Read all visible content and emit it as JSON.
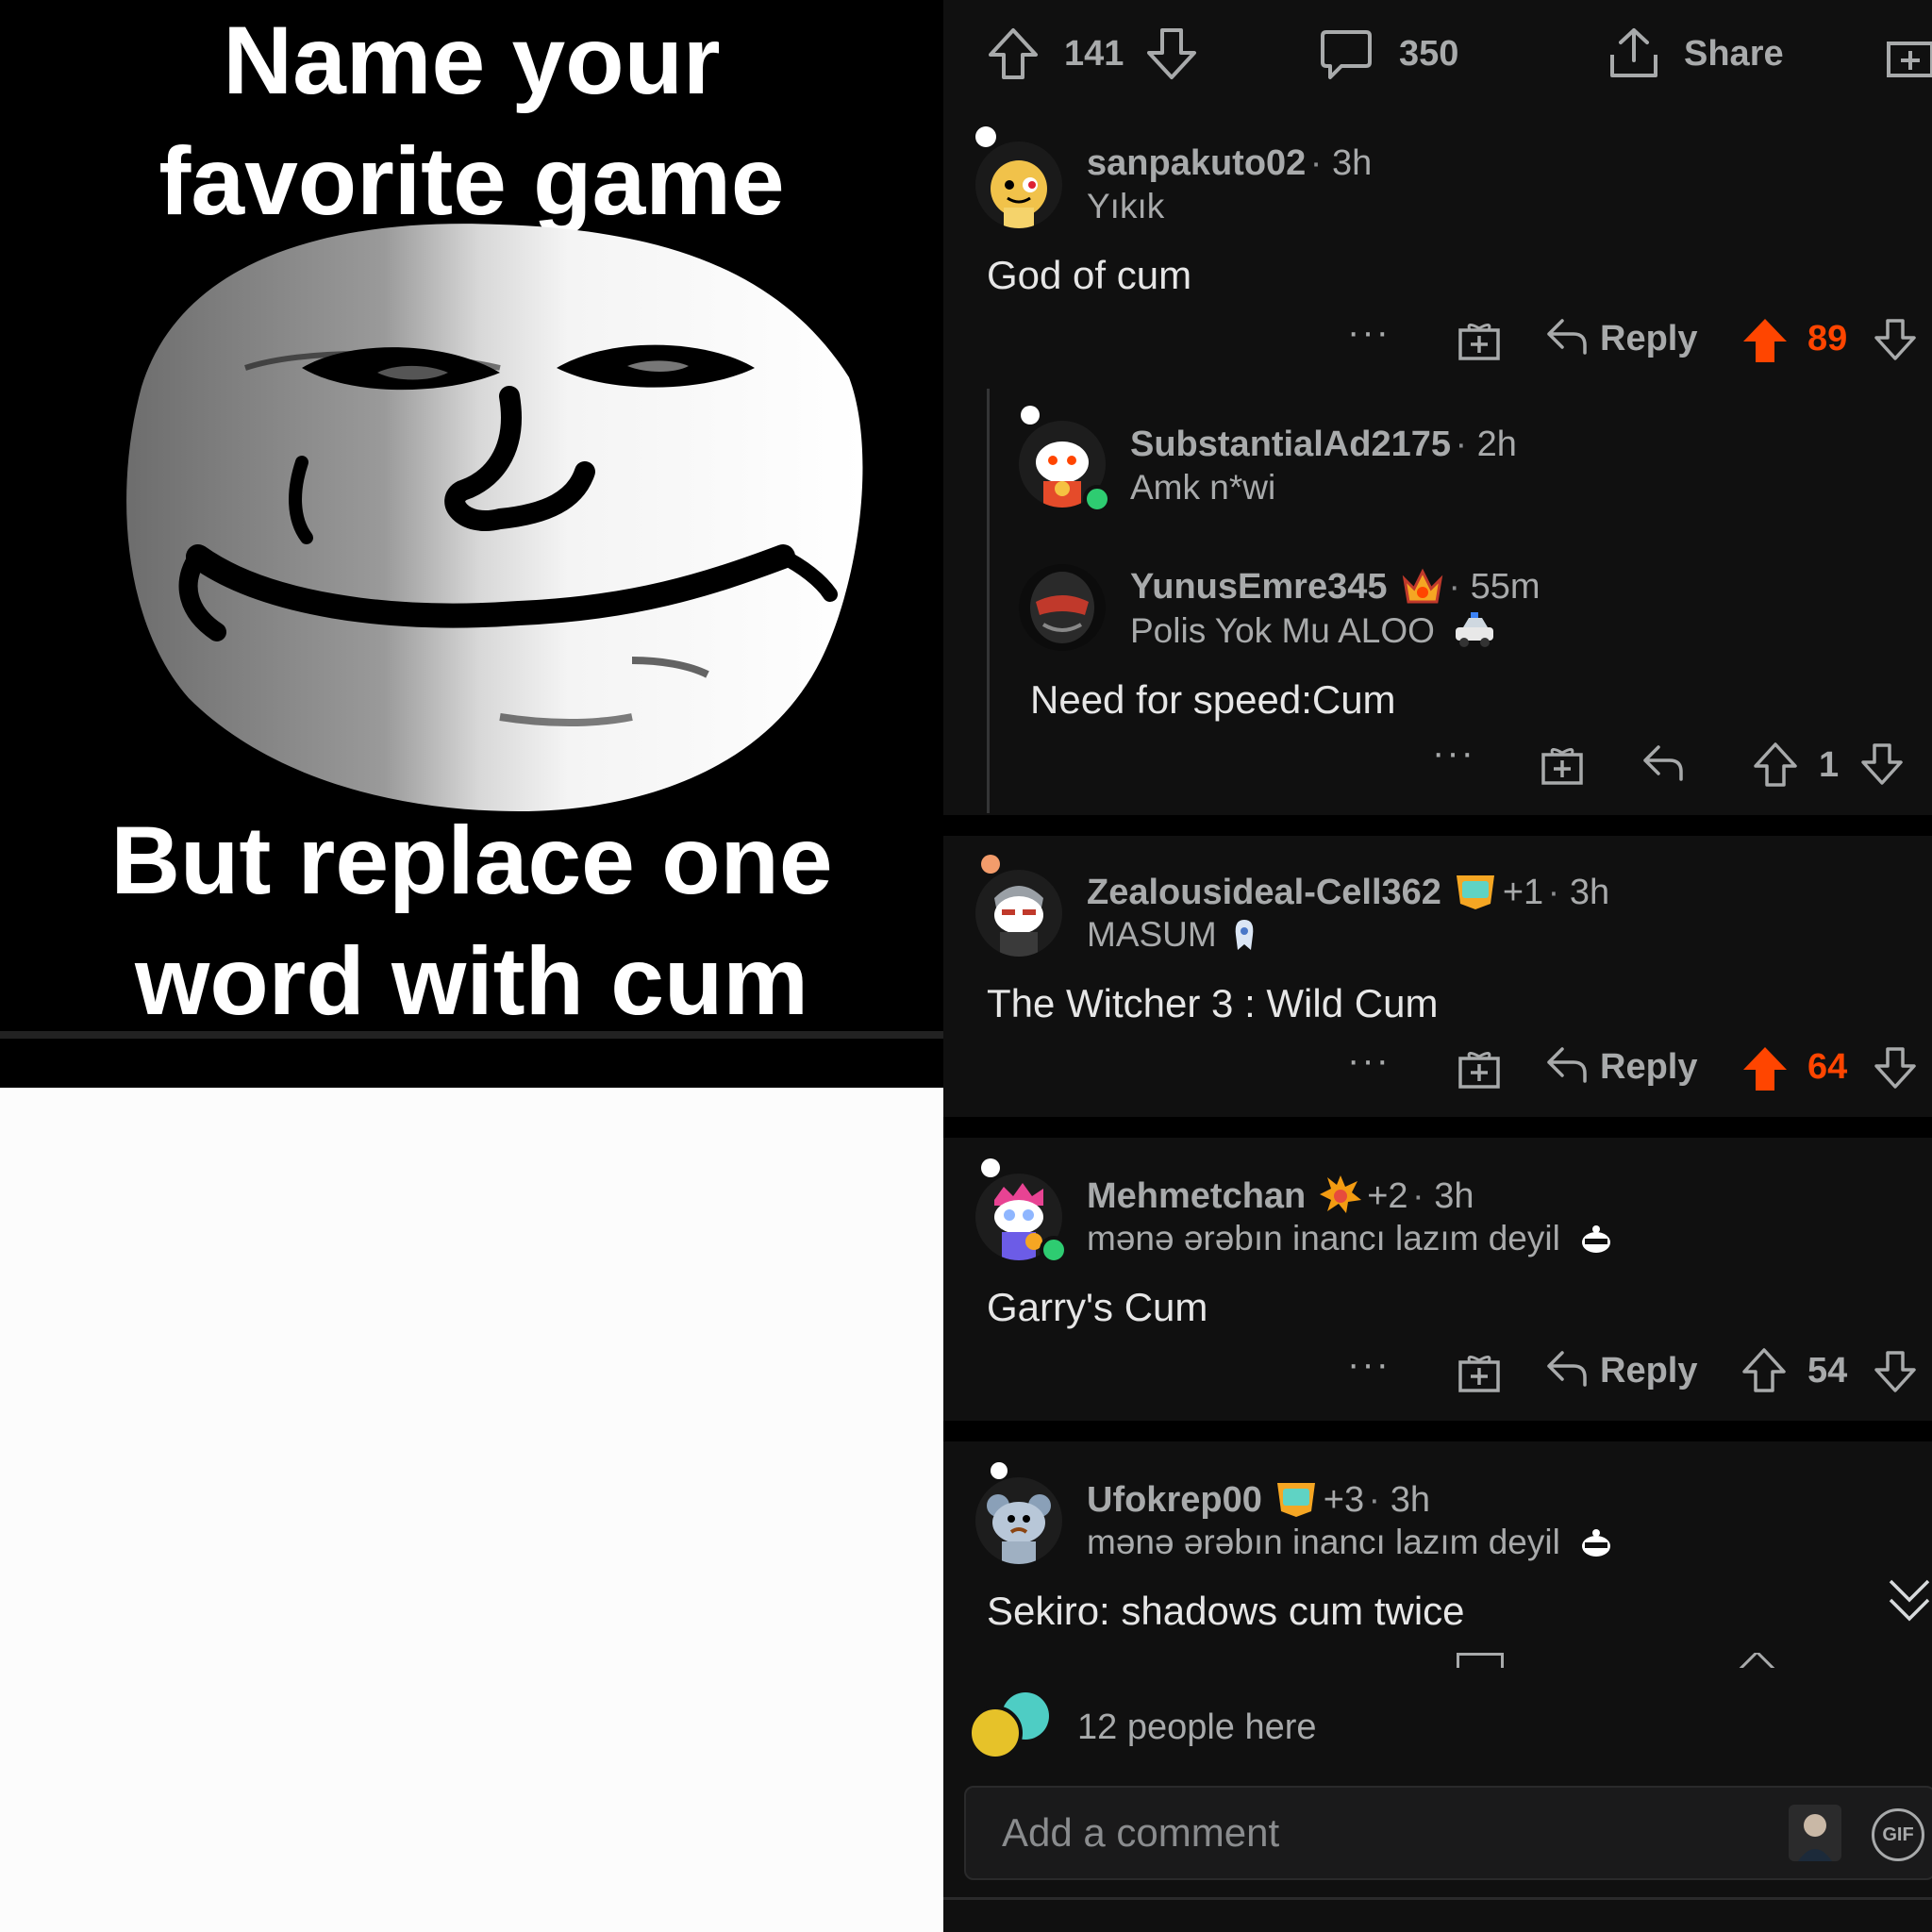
{
  "meme": {
    "top_text_line1": "Name your",
    "top_text_line2": "favorite game",
    "bottom_text_line1": "But replace one",
    "bottom_text_line2": "word with cum"
  },
  "post_bar": {
    "upvote_count": "141",
    "comment_count": "350",
    "share_label": "Share"
  },
  "comments": [
    {
      "username": "sanpakuto02",
      "time": "3h",
      "flair": "Yıkık",
      "body": "God of cum",
      "reply_label": "Reply",
      "score": "89",
      "upvoted": true
    },
    {
      "username": "SubstantialAd2175",
      "time": "2h",
      "flair": "Amk n*wi"
    },
    {
      "username": "YunusEmre345",
      "time": "55m",
      "flair": "Polis Yok Mu ALOO",
      "body": "Need for speed:Cum",
      "score": "1"
    },
    {
      "username": "Zealousideal-Cell362",
      "awards": "+1",
      "time": "3h",
      "flair": "MASUM",
      "body": "The Witcher 3 : Wild Cum",
      "reply_label": "Reply",
      "score": "64",
      "upvoted": true
    },
    {
      "username": "Mehmetchan",
      "awards": "+2",
      "time": "3h",
      "flair": "mənə ərəbın inancı lazım deyil",
      "body": "Garry's Cum",
      "reply_label": "Reply",
      "score": "54"
    },
    {
      "username": "Ufokrep00",
      "awards": "+3",
      "time": "3h",
      "flair": "mənə ərəbın inancı lazım deyil",
      "body": "Sekiro: shadows cum twice"
    }
  ],
  "presence": {
    "text": "12 people here"
  },
  "composer": {
    "placeholder": "Add a comment",
    "gif_label": "GIF"
  },
  "colors": {
    "upvote_active": "#ff4500",
    "background": "#101010",
    "online_dot": "#2ecc71"
  }
}
